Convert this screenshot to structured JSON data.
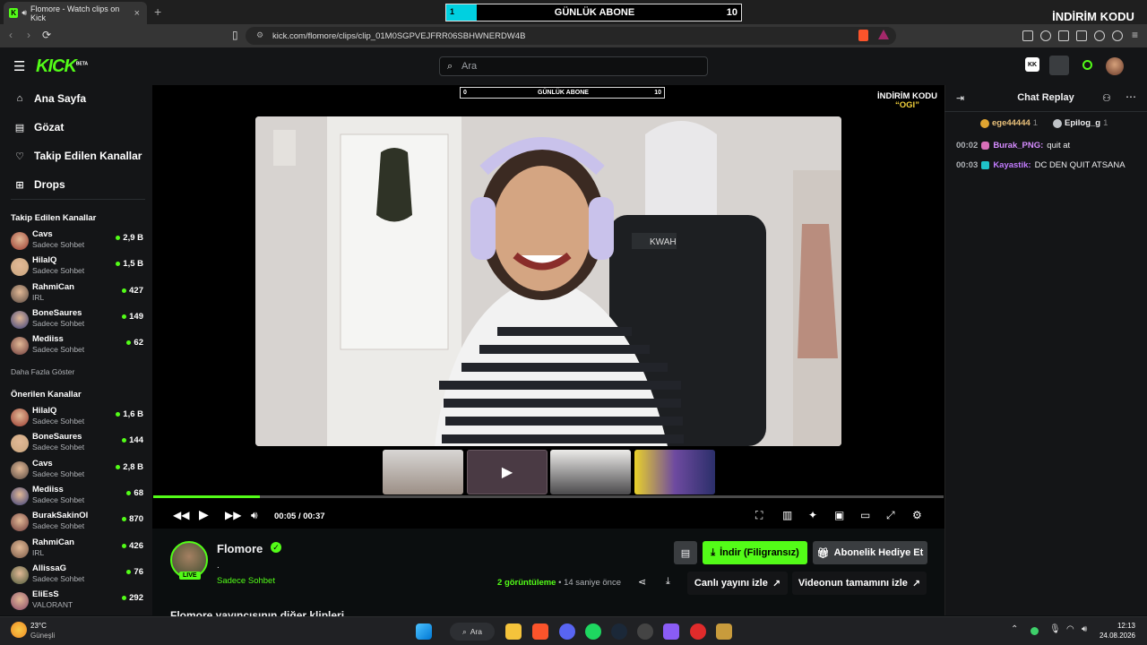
{
  "browser": {
    "tab_title": "Flomore - Watch clips on Kick",
    "url": "kick.com/flomore/clips/clip_01M0SGPVEJFRR06SBHWNERDW4B"
  },
  "overlay": {
    "sub_bar_label": "GÜNLÜK ABONE",
    "sub_bar_left": "1",
    "sub_bar_right": "10",
    "inner_sub_left": "0",
    "inner_sub_right": "10",
    "promo_line1": "İNDİRİM KODU",
    "promo_line2": "“OGI”"
  },
  "header": {
    "logo": "KICK",
    "logo_tag": "BETA",
    "search_placeholder": "Ara"
  },
  "sidebar": {
    "nav": [
      {
        "label": "Ana Sayfa",
        "icon": "home-icon"
      },
      {
        "label": "Gözat",
        "icon": "browse-icon"
      },
      {
        "label": "Takip Edilen Kanallar",
        "icon": "heart-icon"
      },
      {
        "label": "Drops",
        "icon": "drops-icon"
      }
    ],
    "followed_title": "Takip Edilen Kanallar",
    "followed": [
      {
        "name": "Cavs",
        "category": "Sadece Sohbet",
        "viewers": "2,9 B"
      },
      {
        "name": "HilalQ",
        "category": "Sadece Sohbet",
        "viewers": "1,5 B"
      },
      {
        "name": "RahmiCan",
        "category": "IRL",
        "viewers": "427"
      },
      {
        "name": "BoneSaures",
        "category": "Sadece Sohbet",
        "viewers": "149"
      },
      {
        "name": "Mediiss",
        "category": "Sadece Sohbet",
        "viewers": "62"
      }
    ],
    "show_more": "Daha Fazla Göster",
    "recommended_title": "Önerilen Kanallar",
    "recommended": [
      {
        "name": "HilalQ",
        "category": "Sadece Sohbet",
        "viewers": "1,6 B"
      },
      {
        "name": "BoneSaures",
        "category": "Sadece Sohbet",
        "viewers": "144"
      },
      {
        "name": "Cavs",
        "category": "Sadece Sohbet",
        "viewers": "2,8 B"
      },
      {
        "name": "Mediiss",
        "category": "Sadece Sohbet",
        "viewers": "68"
      },
      {
        "name": "BurakSakinOl",
        "category": "Sadece Sohbet",
        "viewers": "870"
      },
      {
        "name": "RahmiCan",
        "category": "IRL",
        "viewers": "426"
      },
      {
        "name": "AllissaG",
        "category": "Sadece Sohbet",
        "viewers": "76"
      },
      {
        "name": "EliEsS",
        "category": "VALORANT",
        "viewers": "292"
      }
    ]
  },
  "player": {
    "time_current": "00:05",
    "time_separator": "/",
    "time_total": "00:37",
    "progress": 0.135
  },
  "clip_info": {
    "channel": "Flomore",
    "live_badge": "LIVE",
    "title": ".",
    "category": "Sadece Sohbet",
    "views_count": "2",
    "views_label": "görüntüleme",
    "age": "• 14 saniye önce",
    "download_label": "İndir (Filigransız)",
    "gift_label": "Abonelik Hediye Et",
    "watch_live_label": "Canlı yayını izle",
    "watch_full_label": "Videonun tamamını izle",
    "more_clips_heading": "Flomore yayıncısının diğer klipleri"
  },
  "chat": {
    "title": "Chat Replay",
    "top_users": [
      {
        "name": "ege44444",
        "rank": "1"
      },
      {
        "name": "Epilog_g",
        "rank": "1"
      }
    ],
    "messages": [
      {
        "time": "00:02",
        "user": "Burak_PNG",
        "text": "quit at",
        "color": "#d68cff"
      },
      {
        "time": "00:03",
        "user": "Kayastik",
        "text": "DC DEN QUIT ATSANA",
        "color": "#c27cff"
      }
    ]
  },
  "taskbar": {
    "weather_temp": "23°C",
    "weather_label": "Güneşli",
    "search_label": "Ara",
    "time": "12:13",
    "date": "24.08.2026"
  },
  "colors": {
    "accent": "#53fc18",
    "background": "#0b0e0f",
    "panel": "#141517"
  }
}
